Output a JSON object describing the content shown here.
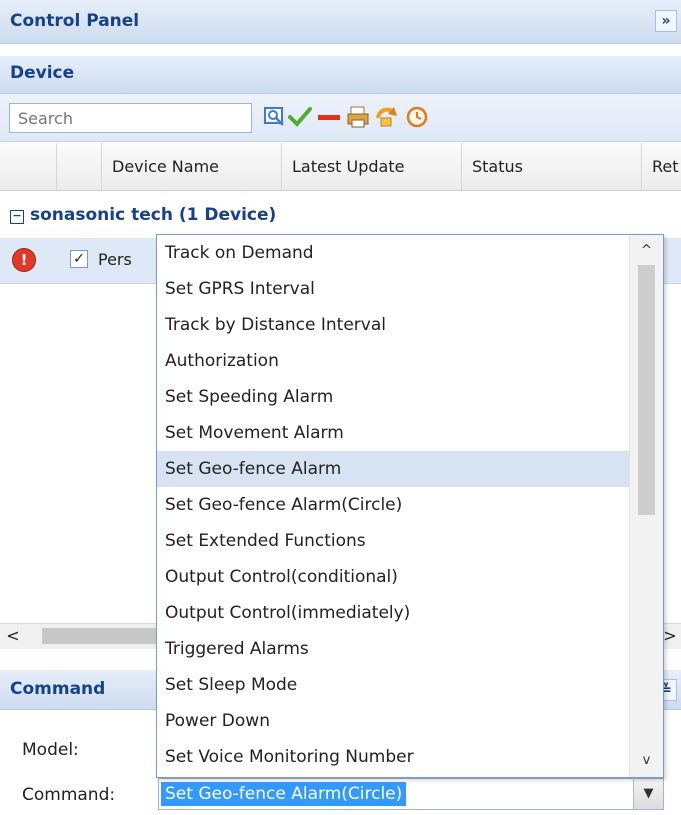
{
  "control_panel": {
    "title": "Control Panel",
    "collapse_label": "»"
  },
  "device_panel": {
    "title": "Device",
    "search": {
      "placeholder": "Search"
    },
    "toolbar_icons": [
      "locate-icon",
      "checkmark-icon",
      "minus-icon",
      "printer-icon",
      "refresh-icon",
      "clock-icon"
    ],
    "columns": [
      "",
      "",
      "Device Name",
      "Latest Update",
      "Status",
      "Ret"
    ],
    "group": {
      "toggle": "−",
      "label": "sonasonic tech (1 Device)"
    },
    "row": {
      "alert": "!",
      "check": "✓",
      "name_partial": "Pers"
    }
  },
  "hscroll": {
    "left_arrow": "<",
    "right_arrow": ">"
  },
  "command_panel": {
    "title": "Command",
    "collapse_label": "≚",
    "model_label": "Model:",
    "command_label": "Command:",
    "command_value": "Set Geo-fence Alarm(Circle)"
  },
  "dropdown": {
    "highlighted_index": 6,
    "scroll_up": "^",
    "scroll_down": "v",
    "items": [
      "Track on Demand",
      "Set GPRS Interval",
      "Track by Distance Interval",
      "Authorization",
      "Set Speeding Alarm",
      "Set Movement Alarm",
      "Set Geo-fence Alarm",
      "Set Geo-fence Alarm(Circle)",
      "Set Extended Functions",
      "Output Control(conditional)",
      "Output Control(immediately)",
      "Triggered Alarms",
      "Set Sleep Mode",
      "Power Down",
      "Set Voice Monitoring Number"
    ]
  },
  "colors": {
    "header_text": "#15428b",
    "selection": "#3399ff",
    "highlight": "#d7e3f3",
    "alert": "#e0392b"
  }
}
